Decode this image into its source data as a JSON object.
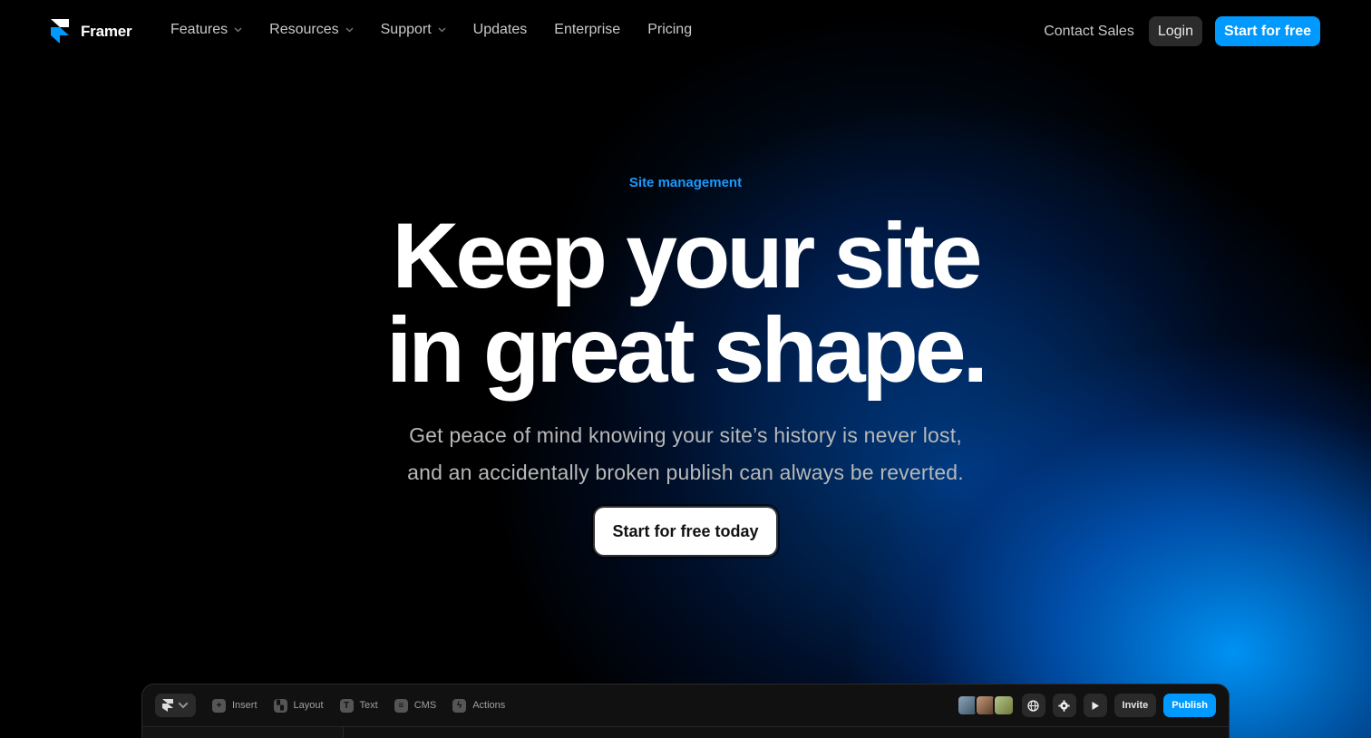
{
  "brand": {
    "name": "Framer"
  },
  "nav": {
    "links": [
      {
        "label": "Features",
        "dropdown": true
      },
      {
        "label": "Resources",
        "dropdown": true
      },
      {
        "label": "Support",
        "dropdown": true
      },
      {
        "label": "Updates",
        "dropdown": false
      },
      {
        "label": "Enterprise",
        "dropdown": false
      },
      {
        "label": "Pricing",
        "dropdown": false
      }
    ],
    "contact_label": "Contact Sales",
    "login_label": "Login",
    "start_label": "Start for free"
  },
  "hero": {
    "eyebrow": "Site management",
    "headline_line1": "Keep your site",
    "headline_line2": "in great shape.",
    "sub_line1": "Get peace of mind knowing your site’s history is never lost,",
    "sub_line2": "and an accidentally broken publish can always be reverted.",
    "cta_label": "Start for free today"
  },
  "editor": {
    "tools": [
      {
        "label": "Insert",
        "icon": "plus-icon"
      },
      {
        "label": "Layout",
        "icon": "layout-icon"
      },
      {
        "label": "Text",
        "icon": "text-icon"
      },
      {
        "label": "CMS",
        "icon": "database-icon"
      },
      {
        "label": "Actions",
        "icon": "lightning-icon"
      }
    ],
    "invite_label": "Invite",
    "publish_label": "Publish"
  },
  "colors": {
    "accent": "#0099ff",
    "background": "#000000",
    "eyebrow": "#1a9bff"
  }
}
